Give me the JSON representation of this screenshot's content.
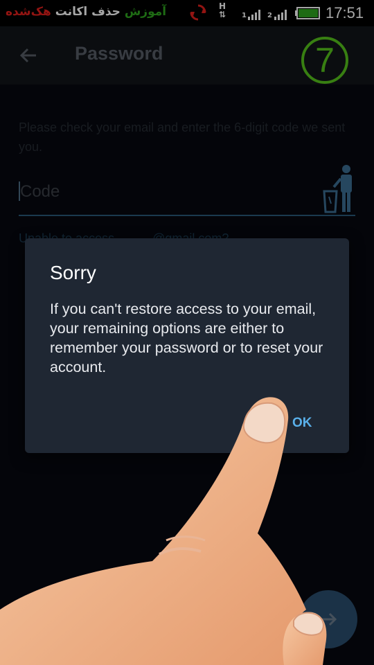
{
  "status_bar": {
    "overlay_title_parts": {
      "red": "هک‌شده",
      "white": "حذف اکانت",
      "green": "آموزش"
    },
    "network_label": "H",
    "sim1_label": "1",
    "sim2_label": "2",
    "time": "17:51",
    "battery_color": "#2fa51f",
    "brand_red": "#e0201c"
  },
  "app_bar": {
    "title": "Password",
    "back_icon": "arrow-left-icon",
    "step_number": "7",
    "step_color": "#57c41c"
  },
  "form": {
    "hint": "Please check your email and enter the 6-digit code we sent you.",
    "code_placeholder": "Code",
    "code_value": "",
    "unable_link": "Unable to access ..........@gmail.com?"
  },
  "dialog": {
    "title": "Sorry",
    "body": "If you can't restore access to your email, your remaining options are either to remember your password or to reset your account.",
    "ok_label": "OK",
    "accent": "#5ab0ea"
  },
  "fab": {
    "icon": "arrow-right-icon"
  }
}
